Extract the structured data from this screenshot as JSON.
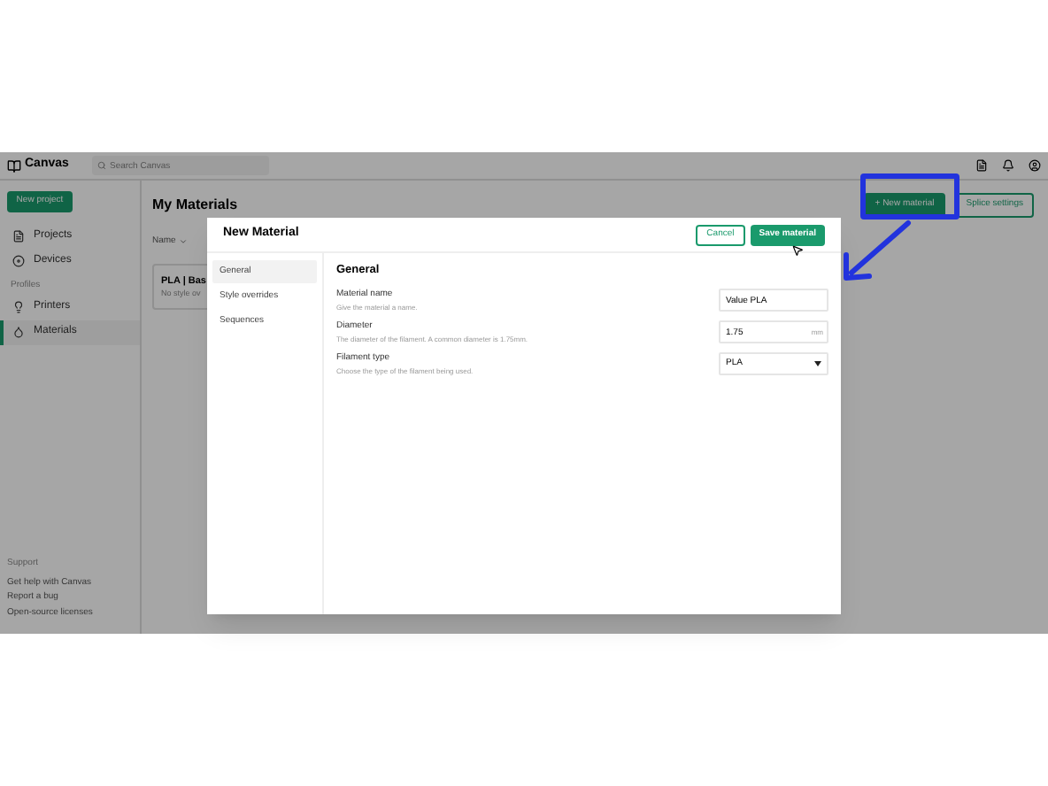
{
  "app": {
    "logo": "Canvas",
    "search": {
      "placeholder": "Search Canvas"
    }
  },
  "sidebar": {
    "new_button": "New project",
    "items": [
      {
        "label": "Projects",
        "selected": false
      },
      {
        "label": "Devices",
        "selected": false
      }
    ],
    "section": "Profiles",
    "profile_items": [
      {
        "label": "Printers",
        "selected": false
      },
      {
        "label": "Materials",
        "selected": true
      }
    ],
    "support": {
      "title": "Support",
      "links": [
        "Get help with Canvas",
        "Report a bug",
        "Open-source licenses"
      ]
    }
  },
  "main": {
    "title": "My Materials",
    "sort": "Name",
    "new_button": "+ New material",
    "splice_button": "Splice settings",
    "card": {
      "title": "PLA | Bas",
      "subtitle": "No style ov"
    }
  },
  "dialog": {
    "title": "New Material",
    "cancel": "Cancel",
    "save": "Save material",
    "nav": [
      {
        "label": "General",
        "selected": true
      },
      {
        "label": "Style overrides",
        "selected": false
      },
      {
        "label": "Sequences",
        "selected": false
      }
    ],
    "section": "General",
    "fields": [
      {
        "kind": "text",
        "label": "Material name",
        "hint": "Give the material a name.",
        "value": "Value PLA"
      },
      {
        "kind": "unit",
        "label": "Diameter",
        "hint": "The diameter of the filament. A common diameter is 1.75mm.",
        "value": "1.75",
        "unit": "mm"
      },
      {
        "kind": "select",
        "label": "Filament type",
        "hint": "Choose the type of the filament being used.",
        "value": "PLA"
      }
    ]
  }
}
